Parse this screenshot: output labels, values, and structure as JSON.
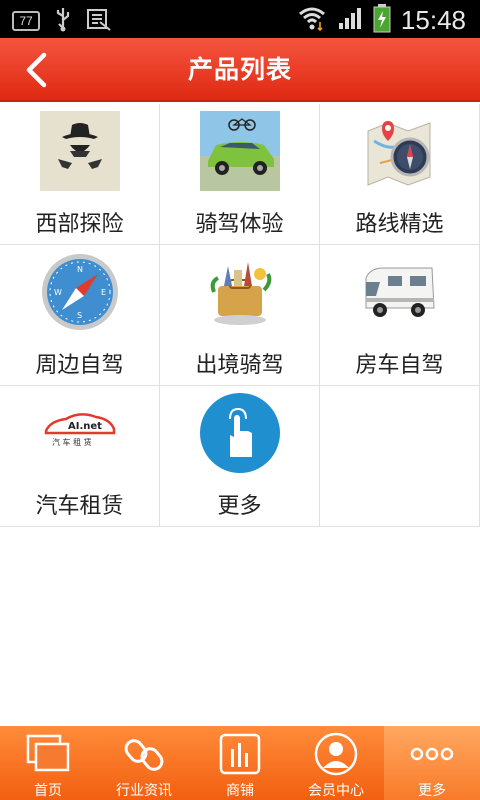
{
  "status_bar": {
    "badge": "77",
    "time": "15:48"
  },
  "header": {
    "title": "产品列表"
  },
  "products": [
    {
      "label": "西部探险",
      "icon": "cowboy-icon"
    },
    {
      "label": "骑驾体验",
      "icon": "suv-bike-photo"
    },
    {
      "label": "路线精选",
      "icon": "map-compass-icon"
    },
    {
      "label": "周边自驾",
      "icon": "compass-icon"
    },
    {
      "label": "出境骑驾",
      "icon": "travel-landmarks-icon"
    },
    {
      "label": "房车自驾",
      "icon": "rv-camper-icon"
    },
    {
      "label": "汽车租赁",
      "icon": "car-rental-logo",
      "logo_text": "AI.net",
      "logo_subtext": "汽 车 租 赁"
    },
    {
      "label": "更多",
      "icon": "tap-more-icon"
    }
  ],
  "tabbar": [
    {
      "label": "首页",
      "icon": "home-pages-icon"
    },
    {
      "label": "行业资讯",
      "icon": "link-chain-icon"
    },
    {
      "label": "商铺",
      "icon": "shop-bars-icon"
    },
    {
      "label": "会员中心",
      "icon": "member-avatar-icon"
    },
    {
      "label": "更多",
      "icon": "more-dots-icon",
      "active": true
    }
  ],
  "colors": {
    "header": "#e83a22",
    "tabbar": "#f57a2c",
    "more_circle": "#1f8fd0"
  }
}
